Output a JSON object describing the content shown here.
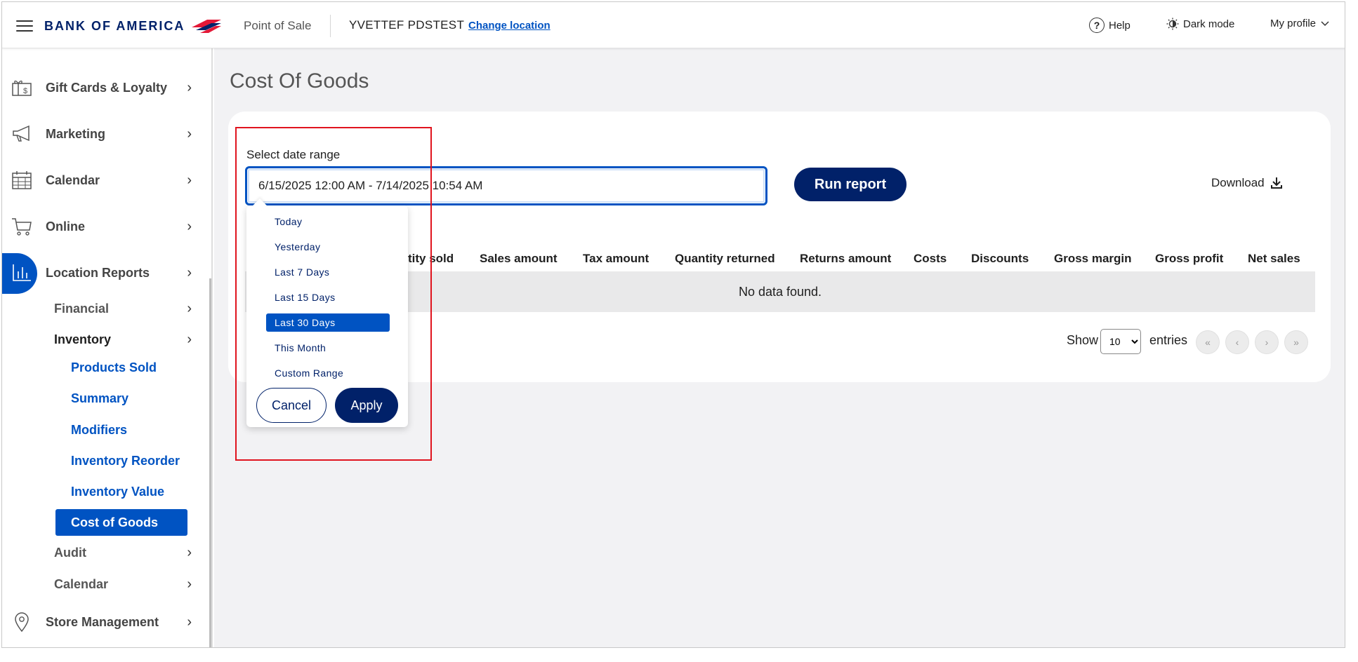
{
  "header": {
    "logo_text": "BANK OF AMERICA",
    "app_name": "Point of Sale",
    "location_name": "YVETTEF PDSTEST",
    "change_location": "Change location",
    "help": "Help",
    "dark_mode": "Dark mode",
    "my_profile": "My profile"
  },
  "sidebar": {
    "items": [
      {
        "label": "Gift Cards & Loyalty",
        "icon": "gift-card-icon"
      },
      {
        "label": "Marketing",
        "icon": "megaphone-icon"
      },
      {
        "label": "Calendar",
        "icon": "calendar-icon"
      },
      {
        "label": "Online",
        "icon": "cart-icon"
      },
      {
        "label": "Location Reports",
        "icon": "bar-chart-icon"
      },
      {
        "label": "Store Management",
        "icon": "location-pin-icon"
      }
    ],
    "sub": {
      "financial": "Financial",
      "inventory": "Inventory",
      "audit": "Audit",
      "calendar": "Calendar"
    },
    "leaves": [
      "Products Sold",
      "Summary",
      "Modifiers",
      "Inventory Reorder",
      "Inventory Value",
      "Cost of Goods"
    ]
  },
  "main": {
    "title": "Cost Of Goods",
    "date_label": "Select date range",
    "date_value": "6/15/2025 12:00 AM - 7/14/2025 10:54 AM",
    "run_report": "Run report",
    "download": "Download",
    "columns": [
      "tity sold",
      "Sales amount",
      "Tax amount",
      "Quantity returned",
      "Returns amount",
      "Costs",
      "Discounts",
      "Gross margin",
      "Gross profit",
      "Net sales"
    ],
    "no_data": "No data found.",
    "show": "Show",
    "page_size": "10",
    "entries": "entries",
    "pagination": [
      "«",
      "‹",
      "›",
      "»"
    ]
  },
  "dropdown": {
    "ranges": [
      "Today",
      "Yesterday",
      "Last 7 Days",
      "Last 15 Days",
      "Last 30 Days",
      "This Month",
      "Custom Range"
    ],
    "selected": "Last 30 Days",
    "cancel": "Cancel",
    "apply": "Apply"
  },
  "colors": {
    "brand_navy": "#012169",
    "accent_blue": "#0053c2",
    "brand_red": "#e31837",
    "highlight_red": "#e0141e"
  }
}
